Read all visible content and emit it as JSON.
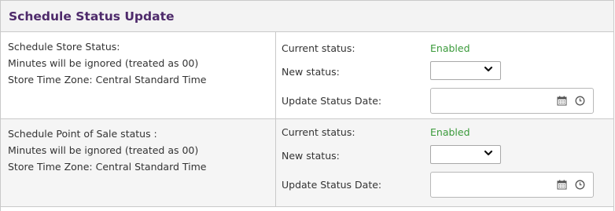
{
  "panel": {
    "title": "Schedule Status Update"
  },
  "sections": [
    {
      "lines": [
        "Schedule Store Status:",
        "Minutes will be ignored (treated as 00)",
        "Store Time Zone: Central Standard Time"
      ],
      "current_status_label": "Current status:",
      "current_status_value": "Enabled",
      "new_status_label": "New status:",
      "new_status_value": "",
      "update_date_label": "Update Status Date:",
      "update_date_value": ""
    },
    {
      "lines": [
        "Schedule Point of Sale status :",
        "Minutes will be ignored (treated as 00)",
        "Store Time Zone: Central Standard Time"
      ],
      "current_status_label": "Current status:",
      "current_status_value": "Enabled",
      "new_status_label": "New status:",
      "new_status_value": "",
      "update_date_label": "Update Status Date:",
      "update_date_value": ""
    }
  ],
  "colors": {
    "title": "#4e2a6b",
    "enabled": "#3a9a3a"
  },
  "icons": [
    "chevron-down-icon",
    "calendar-icon",
    "clock-icon"
  ]
}
